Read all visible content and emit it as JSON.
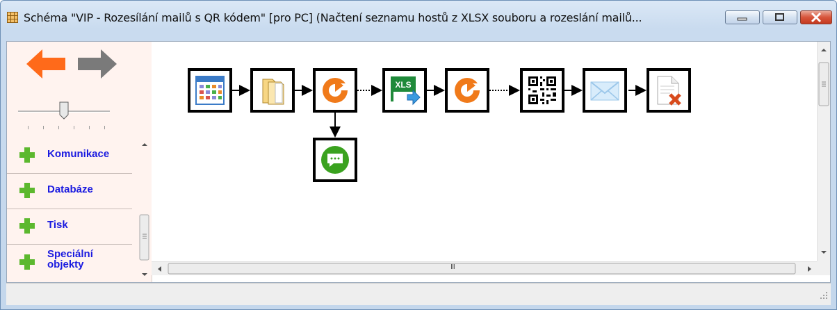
{
  "window": {
    "title": "Schéma \"VIP - Rozesílání mailů s QR kódem\" [pro PC] (Načtení seznamu hostů z XLSX souboru a rozeslání mailů...",
    "controls": [
      "minimize-icon",
      "maximize-icon",
      "close-icon"
    ]
  },
  "nav": {
    "back_icon": "arrow-left-icon",
    "forward_icon": "arrow-right-icon",
    "zoom_level": 0.5
  },
  "categories": [
    {
      "label": "Komunikace",
      "icon": "plus-icon"
    },
    {
      "label": "Databáze",
      "icon": "plus-icon"
    },
    {
      "label": "Tisk",
      "icon": "plus-icon"
    },
    {
      "label": "Speciální objekty",
      "icon": "plus-icon"
    }
  ],
  "flow": {
    "nodes": [
      {
        "id": "calendar",
        "icon": "calendar-icon"
      },
      {
        "id": "folder",
        "icon": "folder-icon"
      },
      {
        "id": "loop1",
        "icon": "loop-icon"
      },
      {
        "id": "xls",
        "icon": "xls-export-icon",
        "text": "XLS"
      },
      {
        "id": "loop2",
        "icon": "loop-icon"
      },
      {
        "id": "qr",
        "icon": "qr-code-icon"
      },
      {
        "id": "mail",
        "icon": "envelope-icon"
      },
      {
        "id": "delete-file",
        "icon": "delete-file-icon"
      },
      {
        "id": "message",
        "icon": "chat-bubble-icon"
      }
    ],
    "connections": [
      {
        "from": "calendar",
        "to": "folder",
        "style": "solid"
      },
      {
        "from": "folder",
        "to": "loop1",
        "style": "solid"
      },
      {
        "from": "loop1",
        "to": "xls",
        "style": "dotted"
      },
      {
        "from": "xls",
        "to": "loop2",
        "style": "solid"
      },
      {
        "from": "loop2",
        "to": "qr",
        "style": "dotted"
      },
      {
        "from": "qr",
        "to": "mail",
        "style": "solid"
      },
      {
        "from": "mail",
        "to": "delete-file",
        "style": "solid"
      },
      {
        "from": "loop1",
        "to": "message",
        "style": "solid"
      }
    ]
  },
  "colors": {
    "title_bg": "#c9dbef",
    "left_panel_bg": "#fff3ef",
    "category_text": "#1a1ae0",
    "back_arrow": "#ff6a1a",
    "forward_arrow": "#808080",
    "plus": "#5cb82e"
  },
  "scrollbar": {
    "hscroll_grip": "III"
  }
}
